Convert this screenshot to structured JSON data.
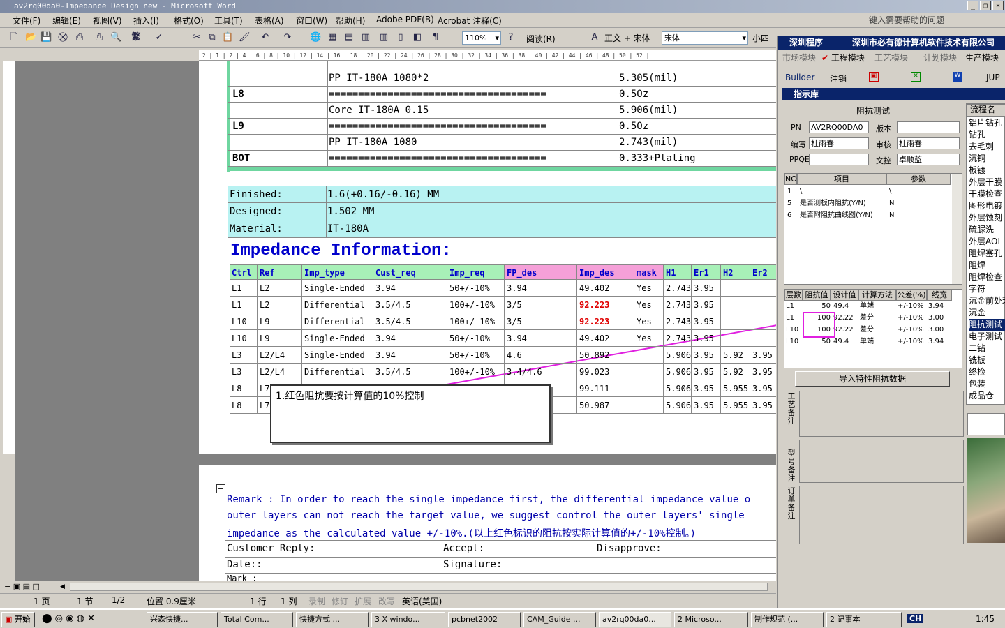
{
  "window": {
    "title": "av2rq00da0-Impedance Design new - Microsoft Word",
    "help_placeholder": "键入需要帮助的问题"
  },
  "menu": [
    "文件(F)",
    "编辑(E)",
    "视图(V)",
    "插入(I)",
    "格式(O)",
    "工具(T)",
    "表格(A)",
    "窗口(W)",
    "帮助(H)",
    "Adobe PDF(B)",
    "Acrobat 注释(C)"
  ],
  "toolbar": {
    "zoom": "110%",
    "read_label": "阅读(R)",
    "style": "正文 + 宋体",
    "font": "宋体",
    "size": "小四",
    "trad": "繁"
  },
  "stackup": [
    {
      "layer": "",
      "material": "PP      IT-180A     1080*2",
      "value": "5.305(mil)"
    },
    {
      "layer": "L8",
      "material": "=====================================",
      "value": "0.5Oz"
    },
    {
      "layer": "",
      "material": "Core      IT-180A     0.15",
      "value": "5.906(mil)"
    },
    {
      "layer": "L9",
      "material": "=====================================",
      "value": "0.5Oz"
    },
    {
      "layer": "",
      "material": "PP      IT-180A     1080",
      "value": "2.743(mil)"
    },
    {
      "layer": "BOT",
      "material": "=====================================",
      "value": "0.333+Plating"
    }
  ],
  "summary": [
    {
      "label": "Finished:",
      "value": "1.6(+0.16/-0.16) MM"
    },
    {
      "label": "Designed:",
      "value": "1.502 MM"
    },
    {
      "label": "Material:",
      "value": "IT-180A"
    }
  ],
  "impedance": {
    "title": "Impedance Information:",
    "headers": [
      "Ctrl",
      "Ref",
      "Imp_type",
      "Cust_req",
      "Imp_req",
      "FP_des",
      "Imp_des",
      "mask",
      "H1",
      "Er1",
      "H2",
      "Er2"
    ],
    "rows": [
      [
        "L1",
        "L2",
        "Single-Ended",
        "3.94",
        "50+/-10%",
        "3.94",
        "49.402",
        "Yes",
        "2.743",
        "3.95",
        "",
        ""
      ],
      [
        "L1",
        "L2",
        "Differential",
        "3.5/4.5",
        "100+/-10%",
        "3/5",
        "92.223",
        "Yes",
        "2.743",
        "3.95",
        "",
        ""
      ],
      [
        "L10",
        "L9",
        "Differential",
        "3.5/4.5",
        "100+/-10%",
        "3/5",
        "92.223",
        "Yes",
        "2.743",
        "3.95",
        "",
        ""
      ],
      [
        "L10",
        "L9",
        "Single-Ended",
        "3.94",
        "50+/-10%",
        "3.94",
        "49.402",
        "Yes",
        "2.743",
        "3.95",
        "",
        ""
      ],
      [
        "L3",
        "L2/L4",
        "Single-Ended",
        "3.94",
        "50+/-10%",
        "4.6",
        "50.892",
        "",
        "5.906",
        "3.95",
        "5.92",
        "3.95"
      ],
      [
        "L3",
        "L2/L4",
        "Differential",
        "3.5/4.5",
        "100+/-10%",
        "3.4/4.6",
        "99.023",
        "",
        "5.906",
        "3.95",
        "5.92",
        "3.95"
      ],
      [
        "L8",
        "L7",
        "",
        "",
        "",
        "",
        "99.111",
        "",
        "5.906",
        "3.95",
        "5.955",
        "3.95"
      ],
      [
        "L8",
        "L7",
        "",
        "",
        "",
        "",
        "50.987",
        "",
        "5.906",
        "3.95",
        "5.955",
        "3.95"
      ]
    ]
  },
  "callout": "1.红色阻抗要按计算值的10%控制",
  "remark": {
    "line1": "Remark : In order to reach the single impedance first, the differential impedance value o",
    "line2": "outer layers can not reach the target value, we suggest control the outer layers' single",
    "line3": "impedance as the calculated value +/-10%.(以上红色标识的阻抗按实际计算值的+/-10%控制。)",
    "customer_reply": "Customer Reply:",
    "accept": "Accept:",
    "disapprove": "Disapprove:",
    "date": "Date::",
    "signature": "Signature:",
    "mark": "Mark :"
  },
  "status": {
    "page": "1 页",
    "section": "1 节",
    "pages": "1/2",
    "position": "位置 0.9厘米",
    "line": "1 行",
    "col": "1 列",
    "rec": "录制",
    "trk": "修订",
    "ext": "扩展",
    "ovr": "改写",
    "lang": "英语(美国)"
  },
  "taskbar": {
    "start": "开始",
    "items": [
      "兴森快捷...",
      "Total Com...",
      "快捷方式 ...",
      "3 X windo...",
      "pcbnet2002",
      "CAM_Guide ...",
      "av2rq00da0...",
      "2 Microso...",
      "制作规范 (...",
      "2 记事本"
    ],
    "clock": "1:45",
    "ime": "CH"
  },
  "panel": {
    "header_left": "深圳程序",
    "header_right": "深圳市必有德计算机软件技术有限公司",
    "modules": [
      "市场模块",
      "工程模块",
      "工艺模块",
      "计划模块",
      "生产模块"
    ],
    "builder": "Builder",
    "logout": "注销",
    "jump": "JUP",
    "lib_title": "指示库",
    "section_title": "阻抗测试",
    "fields": {
      "pn_label": "PN",
      "pn": "AV2RQ00DA0",
      "ver_label": "版本",
      "ver": "",
      "author_label": "编写",
      "author": "杜雨春",
      "review_label": "审核",
      "review": "杜雨春",
      "ppqe_label": "PPQE",
      "ppqe": "",
      "ctrl_label": "文控",
      "ctrl": "卓顺蓝"
    },
    "items_header": [
      "NO",
      "项目",
      "参数"
    ],
    "items": [
      [
        "1",
        "\\",
        "\\"
      ],
      [
        "5",
        "是否测板内阻抗(Y/N)",
        "N"
      ],
      [
        "6",
        "是否附阻抗曲线图(Y/N)",
        "N"
      ]
    ],
    "imp_header": [
      "层数",
      "阻抗值",
      "设计值",
      "计算方法",
      "公差(%)",
      "线宽"
    ],
    "imp_rows": [
      [
        "L1",
        "50",
        "49.4",
        "单端",
        "+/-10%",
        "3.94"
      ],
      [
        "L1",
        "100",
        "92.22",
        "差分",
        "+/-10%",
        "3.00"
      ],
      [
        "L10",
        "100",
        "92.22",
        "差分",
        "+/-10%",
        "3.00"
      ],
      [
        "L10",
        "50",
        "49.4",
        "单端",
        "+/-10%",
        "3.94"
      ]
    ],
    "import_btn": "导入特性阻抗数据",
    "note1": "工艺备注",
    "note2": "型号备注",
    "note3": "订单备注",
    "flow_header": "流程名",
    "flow": [
      "铝片钻孔",
      "钻孔",
      "去毛刺",
      "沉铜",
      "板镀",
      "外层干膜",
      "干膜检查",
      "图形电镀",
      "外层蚀刻",
      "硫脲洗",
      "外层AOI",
      "阻焊塞孔",
      "阻焊",
      "阻焊检查",
      "字符",
      "沉金前处理",
      "沉金",
      "阻抗测试",
      "电子测试",
      "二钻",
      "铣板",
      "终检",
      "包装",
      "成品仓"
    ],
    "flow_selected": 17
  },
  "colors": {
    "cyan_fill": "#b8f2f2",
    "green_head": "#a8f0b8",
    "pink_head": "#f5a0d8",
    "blue_text": "#0000cc",
    "red_value": "#e00000",
    "magenta": "#e020e0"
  }
}
